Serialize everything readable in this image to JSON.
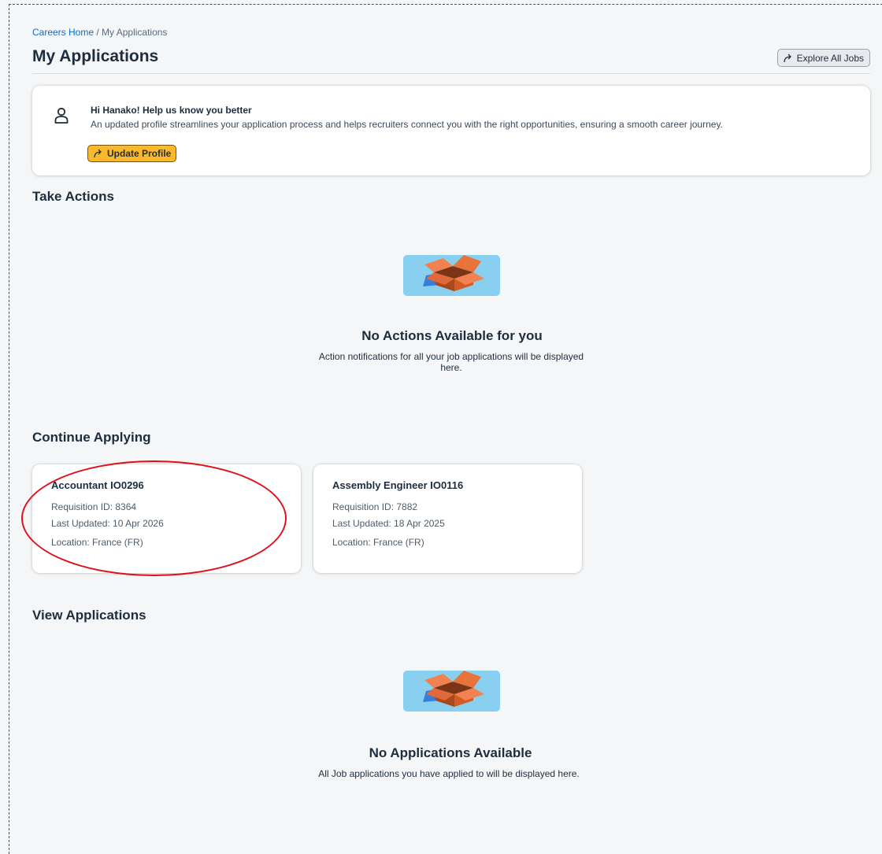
{
  "breadcrumb": {
    "home": "Careers Home",
    "separator": " / ",
    "current": "My Applications"
  },
  "page_title": "My Applications",
  "explore_button": {
    "label": "Explore All Jobs",
    "icon": "share-arrow-icon"
  },
  "profile_card": {
    "icon": "person-icon",
    "heading": "Hi Hanako! Help us know you better",
    "text": "An updated profile streamlines your application process and helps recruiters connect you with the right opportunities, ensuring a smooth career journey.",
    "button_label": "Update Profile"
  },
  "take_actions": {
    "title": "Take Actions",
    "empty_title": "No Actions Available for you",
    "empty_text": "Action notifications for all your job applications will be displayed here."
  },
  "continue_applying": {
    "title": "Continue Applying",
    "cards": [
      {
        "title": "Accountant IO0296",
        "requisition": "Requisition ID: 8364",
        "updated": "Last Updated: 10 Apr 2026",
        "location": "Location: France (FR)"
      },
      {
        "title": "Assembly Engineer IO0116",
        "requisition": "Requisition ID: 7882",
        "updated": "Last Updated: 18 Apr 2025",
        "location": "Location: France (FR)"
      }
    ]
  },
  "view_applications": {
    "title": "View Applications",
    "empty_title": "No Applications Available",
    "empty_text": "All Job applications you have applied to will be displayed here."
  },
  "colors": {
    "accent_button": "#fab92d",
    "link": "#0a6ed1",
    "annotation": "#e0101a",
    "illustration_bg": "#89cff0",
    "box": "#e8743b"
  }
}
